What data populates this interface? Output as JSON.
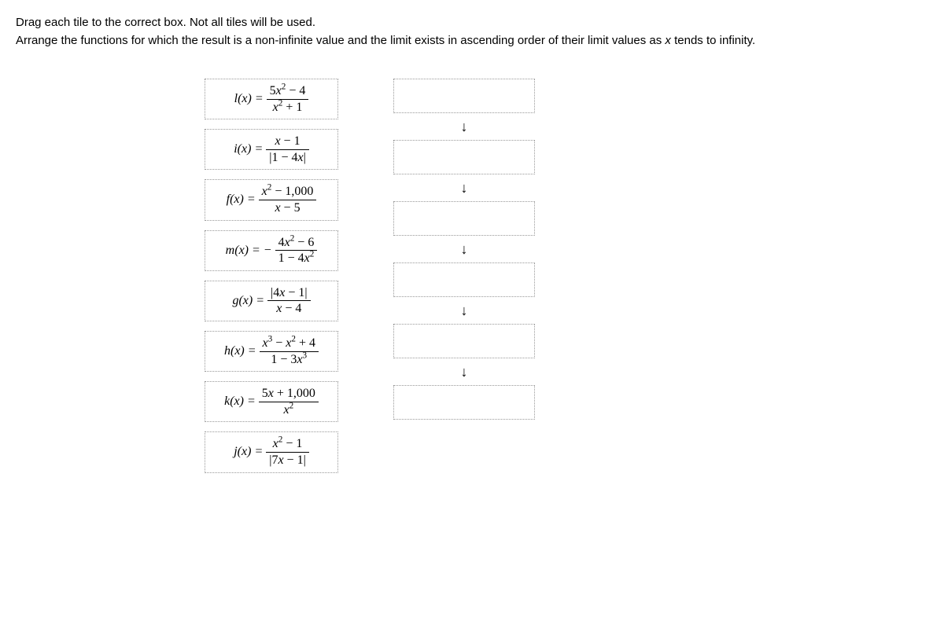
{
  "instructions": "Drag each tile to the correct box. Not all tiles will be used.",
  "question": "Arrange the functions for which the result is a non-infinite value and the limit exists in ascending order of their limit values as x tends to infinity.",
  "tiles": {
    "l": {
      "fn": "l(x) =",
      "num": "5x² − 4",
      "den": "x² + 1"
    },
    "i": {
      "fn": "i(x) =",
      "num": "x − 1",
      "den": "|1 − 4x|"
    },
    "f": {
      "fn": "f(x) =",
      "num": "x² − 1,000",
      "den": "x − 5"
    },
    "m": {
      "fn": "m(x) = −",
      "num": "4x² − 6",
      "den": "1 − 4x²"
    },
    "g": {
      "fn": "g(x) =",
      "num": "|4x − 1|",
      "den": "x − 4"
    },
    "h": {
      "fn": "h(x) =",
      "num": "x³ − x² + 4",
      "den": "1 − 3x³"
    },
    "k": {
      "fn": "k(x) =",
      "num": "5x + 1,000",
      "den": "x²"
    },
    "j": {
      "fn": "j(x) =",
      "num": "x² − 1",
      "den": "|7x − 1|"
    }
  },
  "arrow": "↓"
}
